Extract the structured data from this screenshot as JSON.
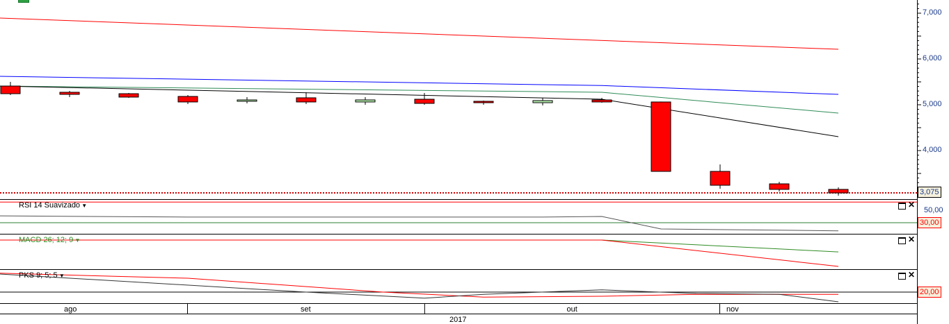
{
  "chart_data": {
    "type": "candlestick",
    "title": "",
    "price_axis": {
      "ticks": [
        {
          "value": 7000,
          "label": "7,000"
        },
        {
          "value": 6000,
          "label": "6,000"
        },
        {
          "value": 5000,
          "label": "5,000"
        },
        {
          "value": 4000,
          "label": "4,000"
        }
      ],
      "last_price_label": "3,075",
      "last_price": 3075
    },
    "candles": [
      {
        "o": 5409,
        "c": 5242,
        "h": 5500,
        "l": 5212
      },
      {
        "o": 5273,
        "c": 5227,
        "h": 5303,
        "l": 5167
      },
      {
        "o": 5242,
        "c": 5167,
        "h": 5258,
        "l": 5152
      },
      {
        "o": 5182,
        "c": 5061,
        "h": 5212,
        "l": 5015
      },
      {
        "o": 5076,
        "c": 5106,
        "h": 5167,
        "l": 5030
      },
      {
        "o": 5152,
        "c": 5061,
        "h": 5273,
        "l": 5015
      },
      {
        "o": 5061,
        "c": 5106,
        "h": 5167,
        "l": 5000
      },
      {
        "o": 5121,
        "c": 5030,
        "h": 5258,
        "l": 5000
      },
      {
        "o": 5076,
        "c": 5045,
        "h": 5090,
        "l": 5000
      },
      {
        "o": 5045,
        "c": 5091,
        "h": 5150,
        "l": 4985
      },
      {
        "o": 5106,
        "c": 5061,
        "h": 5150,
        "l": 5045
      },
      {
        "o": 5061,
        "c": 3545,
        "h": 5070,
        "l": 3545
      },
      {
        "o": 3545,
        "c": 3242,
        "h": 3697,
        "l": 3167
      },
      {
        "o": 3273,
        "c": 3152,
        "h": 3318,
        "l": 3106
      },
      {
        "o": 3152,
        "c": 3075,
        "h": 3197,
        "l": 3015
      }
    ],
    "overlays": [
      {
        "name": "red-band",
        "color": "#ff0000",
        "points": [
          [
            -0.18,
            6894
          ],
          [
            14,
            6212
          ]
        ]
      },
      {
        "name": "blue-band",
        "color": "#0000ff",
        "points": [
          [
            -0.18,
            5621
          ],
          [
            10,
            5420
          ],
          [
            14,
            5227
          ]
        ]
      },
      {
        "name": "green-average",
        "color": "#2e8b57",
        "points": [
          [
            -0.18,
            5409
          ],
          [
            10,
            5273
          ],
          [
            14,
            4818
          ]
        ]
      },
      {
        "name": "black-average",
        "color": "#000000",
        "points": [
          [
            -0.18,
            5409
          ],
          [
            10,
            5121
          ],
          [
            14,
            4303
          ]
        ]
      }
    ],
    "rsi": {
      "title": "RSI 14 Suavizado",
      "level_labels": [
        {
          "value": 50,
          "label": "50,00"
        },
        {
          "value": 30,
          "label": "30,00"
        }
      ],
      "upper_level": 63,
      "lower_level": 30,
      "line": [
        [
          -0.18,
          41
        ],
        [
          3,
          39
        ],
        [
          6,
          39
        ],
        [
          9,
          39
        ],
        [
          10,
          40
        ],
        [
          11,
          20
        ],
        [
          14,
          17
        ]
      ]
    },
    "macd": {
      "title": "MACD 26; 12; 9",
      "macd_line": [
        [
          -0.18,
          0
        ],
        [
          10,
          0
        ],
        [
          14,
          -1.0
        ]
      ],
      "signal_line": [
        [
          -0.18,
          0
        ],
        [
          10,
          0
        ],
        [
          14,
          -0.45
        ]
      ]
    },
    "pks": {
      "title": "PKS 9; 5; 5",
      "level_label": "20,00",
      "level": 20,
      "k_line": [
        [
          -0.18,
          52.5
        ],
        [
          5,
          20
        ],
        [
          7,
          9
        ],
        [
          8,
          16
        ],
        [
          10,
          24
        ],
        [
          11.6,
          17.5
        ],
        [
          13,
          16
        ],
        [
          14,
          2.5
        ]
      ],
      "d_line": [
        [
          -0.18,
          54
        ],
        [
          3,
          45
        ],
        [
          6.3,
          20
        ],
        [
          8,
          11
        ],
        [
          10,
          12.5
        ],
        [
          11.6,
          16
        ],
        [
          14,
          16
        ]
      ]
    },
    "time_axis": {
      "months": [
        {
          "label": "ago",
          "index": 1
        },
        {
          "label": "set",
          "index": 5
        },
        {
          "label": "out",
          "index": 9.5
        },
        {
          "label": "nov",
          "index": 12.2
        }
      ],
      "dividers": [
        3,
        7.01,
        12
      ],
      "year": "2017"
    },
    "colors": {
      "down": "#ff0000",
      "up": "#b8f0b0",
      "last_price": "#cc0000"
    }
  }
}
